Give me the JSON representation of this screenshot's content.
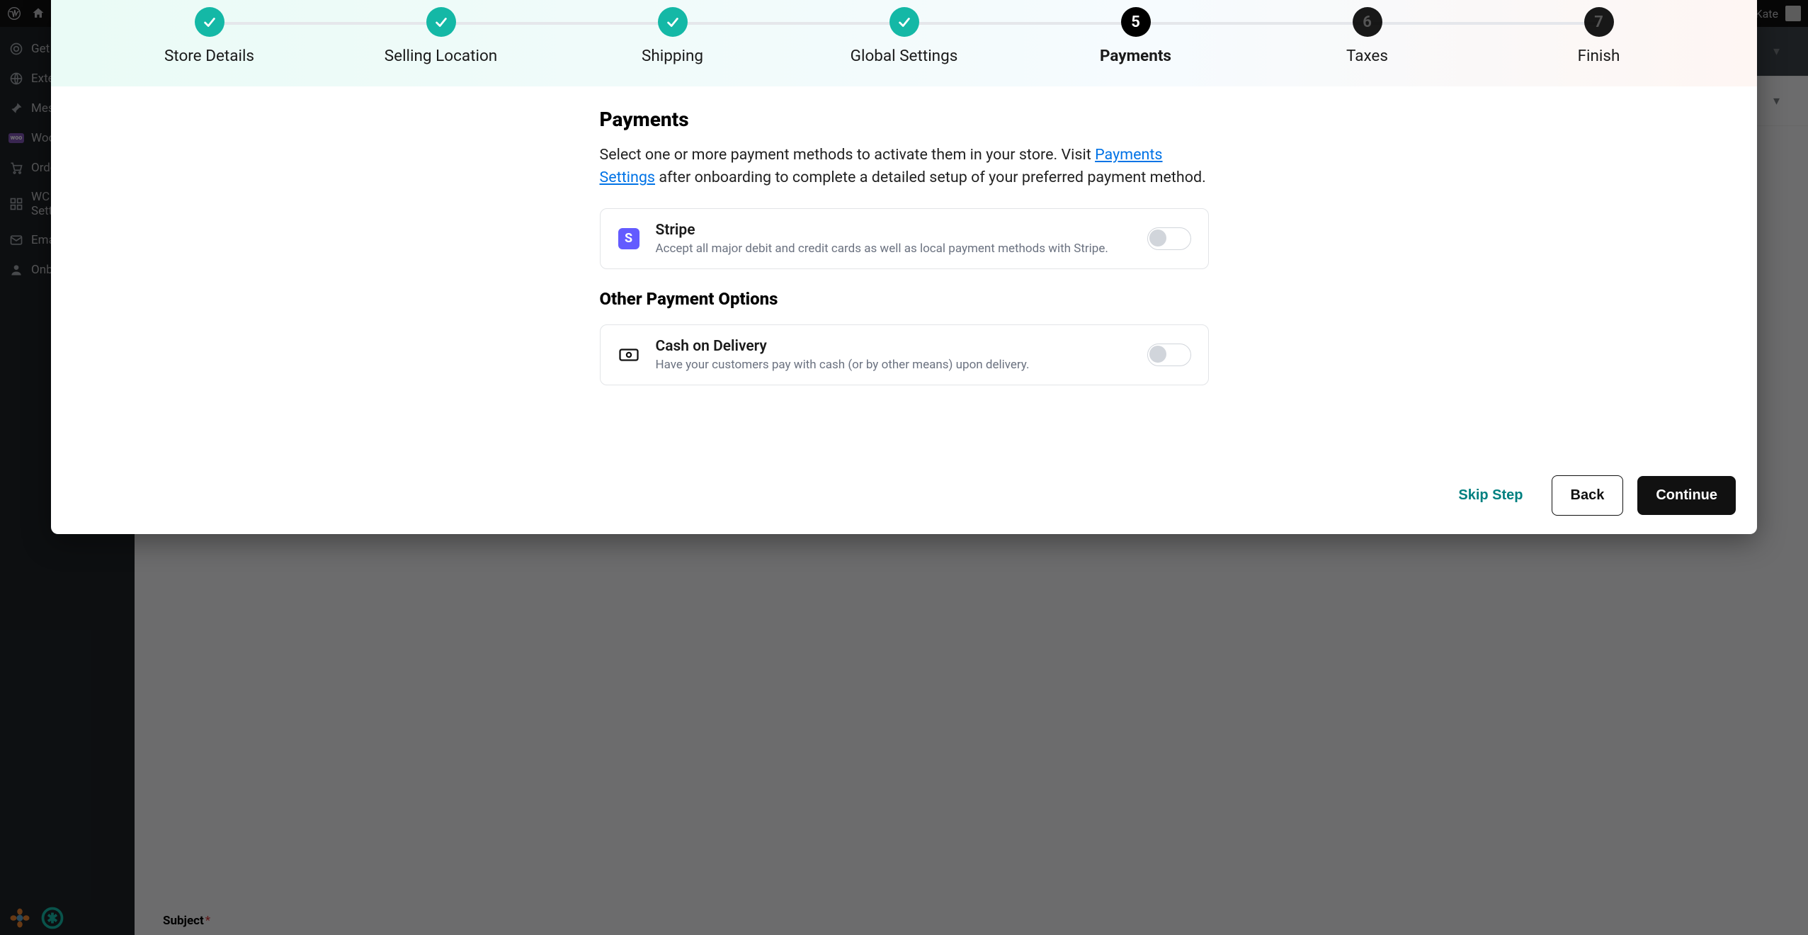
{
  "wp": {
    "user": "Kate",
    "sidebar": [
      {
        "label": "Get",
        "icon": "target"
      },
      {
        "label": "Exte",
        "icon": "globe"
      },
      {
        "label": "Mes",
        "icon": "pin"
      },
      {
        "label": "Woo",
        "icon": "woo"
      },
      {
        "label": "Orde",
        "icon": "cart"
      },
      {
        "label": "WC\nSetti",
        "icon": "grid"
      },
      {
        "label": "Ema",
        "icon": "mail"
      },
      {
        "label": "Onb",
        "icon": "user"
      }
    ],
    "subject_label": "Subject",
    "required_marker": "*"
  },
  "wizard": {
    "steps": [
      {
        "label": "Store Details",
        "state": "done"
      },
      {
        "label": "Selling Location",
        "state": "done"
      },
      {
        "label": "Shipping",
        "state": "done"
      },
      {
        "label": "Global Settings",
        "state": "done"
      },
      {
        "label": "Payments",
        "state": "current",
        "num": "5"
      },
      {
        "label": "Taxes",
        "state": "upcoming",
        "num": "6"
      },
      {
        "label": "Finish",
        "state": "upcoming",
        "num": "7"
      }
    ],
    "heading": "Payments",
    "lead_pre": "Select one or more payment methods to activate them in your store. Visit ",
    "lead_link": "Payments Settings",
    "lead_post": " after onboarding to complete a detailed setup of your preferred payment method.",
    "methods": [
      {
        "id": "stripe",
        "title": "Stripe",
        "desc": "Accept all major debit and credit cards as well as local payment methods with Stripe.",
        "enabled": false
      }
    ],
    "other_heading": "Other Payment Options",
    "other_methods": [
      {
        "id": "cod",
        "title": "Cash on Delivery",
        "desc": "Have your customers pay with cash (or by other means) upon delivery.",
        "enabled": false
      }
    ],
    "footer": {
      "skip": "Skip Step",
      "back": "Back",
      "continue": "Continue"
    }
  }
}
